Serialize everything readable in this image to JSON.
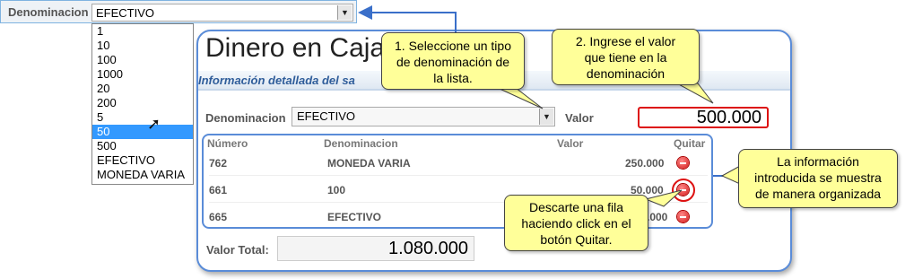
{
  "top": {
    "label": "Denominacion",
    "selected_value": "EFECTIVO",
    "options": [
      "1",
      "10",
      "100",
      "1000",
      "20",
      "200",
      "5",
      "50",
      "500",
      "EFECTIVO",
      "MONEDA VARIA"
    ],
    "highlighted_option": "50"
  },
  "panel": {
    "title": "Dinero en Caja",
    "subtitle": "Información detallada del sa",
    "denominacion_label": "Denominacion",
    "denominacion_value": "EFECTIVO",
    "valor_label": "Valor",
    "valor_value": "500.000",
    "table": {
      "headers": {
        "numero": "Número",
        "denominacion": "Denominacion",
        "valor": "Valor",
        "quitar": "Quitar"
      },
      "rows": [
        {
          "numero": "762",
          "denominacion": "MONEDA VARIA",
          "valor": "250.000"
        },
        {
          "numero": "661",
          "denominacion": "100",
          "valor": "50.000"
        },
        {
          "numero": "665",
          "denominacion": "EFECTIVO",
          "valor": ".000"
        }
      ]
    },
    "total_label": "Valor Total:",
    "total_value": "1.080.000"
  },
  "callouts": {
    "c1": [
      "1. Seleccione un tipo",
      "de denominación de",
      "la lista."
    ],
    "c2": [
      "2. Ingrese el valor",
      "que tiene en la",
      "denominación"
    ],
    "c3": [
      "La información",
      "introducida se muestra",
      "de manera organizada"
    ],
    "c4": [
      "Descarte una fila",
      "haciendo click en el",
      "botón Quitar."
    ]
  },
  "colors": {
    "accent_blue": "#5a8cd8",
    "callout_yellow": "#ffff99",
    "highlight_red": "#d11111",
    "selected_blue": "#3399ff"
  },
  "icons": {
    "select_arrow": "chevron-down-icon",
    "remove": "remove-icon",
    "cursor": "mouse-cursor-icon"
  }
}
